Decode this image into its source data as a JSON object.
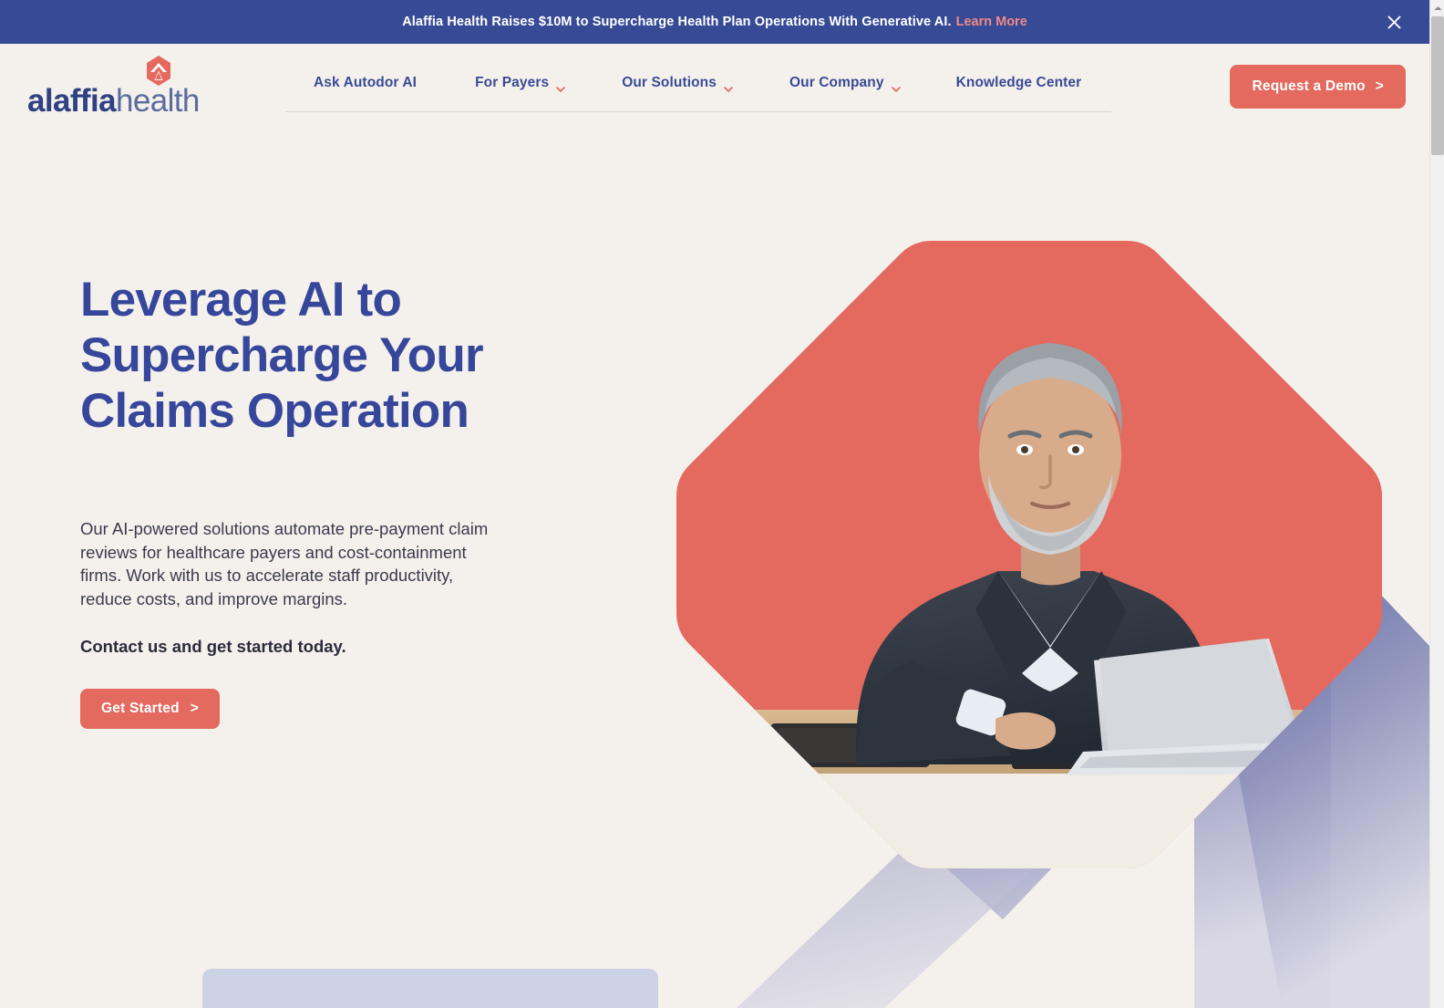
{
  "announcement": {
    "text": "Alaffia Health Raises $10M to Supercharge Health Plan Operations With Generative AI.",
    "link_label": "Learn More",
    "close_icon": "close-icon",
    "background_color": "#374a96",
    "link_color": "#ef8a86"
  },
  "header": {
    "logo": {
      "name_bold": "alaffia",
      "name_light": "health",
      "mark_icon": "shield-chevron-icon",
      "mark_color": "#e4695f",
      "bold_color": "#2f4083",
      "light_color": "#5b6b9e"
    },
    "nav": [
      {
        "label": "Ask Autodor AI",
        "has_caret": false
      },
      {
        "label": "For Payers",
        "has_caret": true
      },
      {
        "label": "Our Solutions",
        "has_caret": true
      },
      {
        "label": "Our Company",
        "has_caret": true
      },
      {
        "label": "Knowledge Center",
        "has_caret": false
      }
    ],
    "nav_color": "#3a4a96",
    "caret_color": "#e4695f",
    "cta": {
      "label": "Request a Demo",
      "arrow": ">",
      "background_color": "#e4695f",
      "text_color": "#ffffff"
    }
  },
  "hero": {
    "title": "Leverage AI to Supercharge Your Claims Operation",
    "title_color": "#36479b",
    "paragraph": "Our AI-powered solutions automate pre-payment claim reviews for healthcare payers and cost-containment firms. Work with us to accelerate staff productivity, reduce costs, and improve margins.",
    "subheading": "Contact us and get started today.",
    "cta": {
      "label": "Get Started",
      "arrow": ">",
      "background_color": "#e4695f",
      "text_color": "#ffffff"
    },
    "art": {
      "hexagon_color": "#e4695f",
      "chevron_gradient_start": "#3b4a95",
      "chevron_gradient_end": "#d8d6e4",
      "photo_alt": "businessman-with-laptop-photo",
      "card_color": "#ccd2e5"
    }
  },
  "page": {
    "background_color": "#f4f1ec"
  },
  "scrollbar": {
    "up_arrow_icon": "scroll-up-arrow-icon",
    "thumb": "scroll-thumb"
  }
}
